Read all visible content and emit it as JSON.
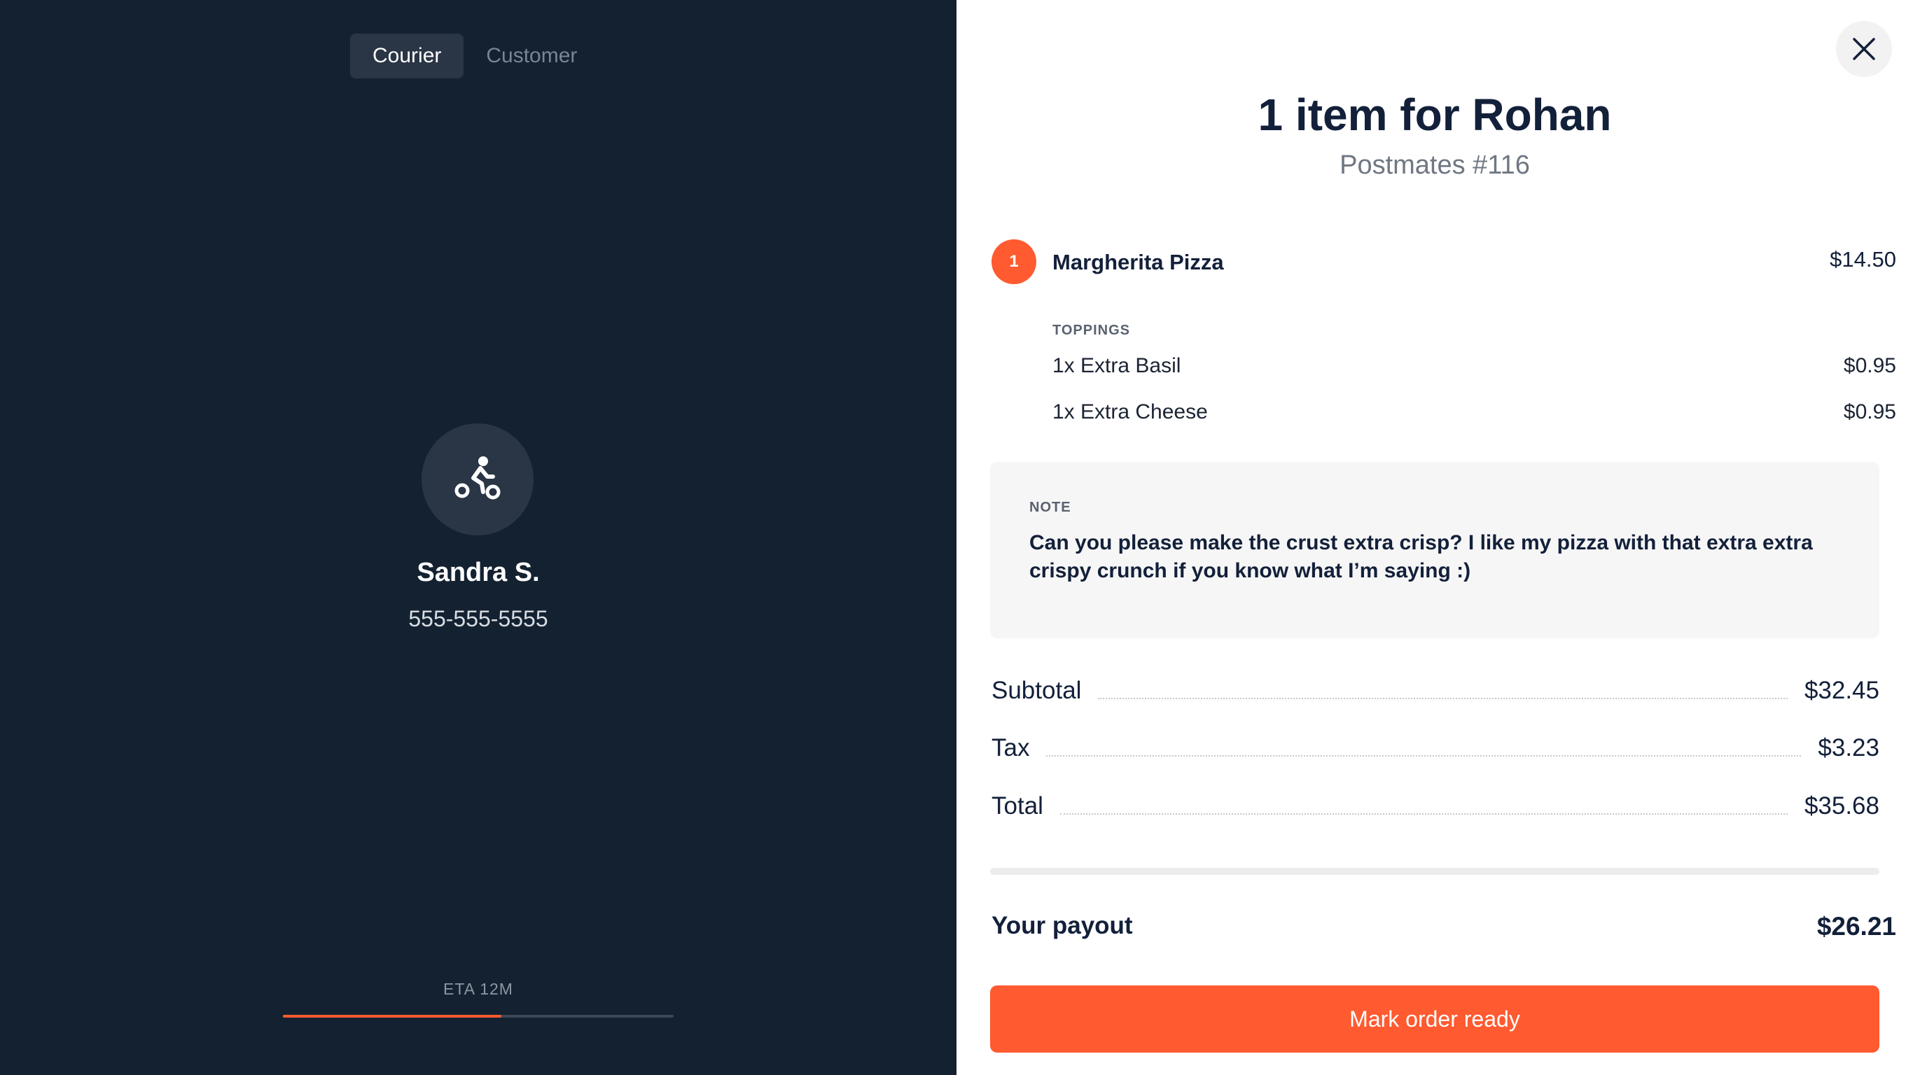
{
  "tabs": [
    {
      "label": "Courier",
      "active": true
    },
    {
      "label": "Customer",
      "active": false
    }
  ],
  "courier": {
    "icon": "cyclist-icon",
    "name": "Sandra S.",
    "phone": "555-555-5555"
  },
  "eta": {
    "label": "ETA 12M",
    "progress": 0.56
  },
  "order": {
    "title": "1 item for Rohan",
    "subtitle": "Postmates #116",
    "items": [
      {
        "quantity": "1",
        "name": "Margherita Pizza",
        "price": "$14.50",
        "modifier_group": "TOPPINGS",
        "modifiers": [
          {
            "label": "1x Extra Basil",
            "price": "$0.95"
          },
          {
            "label": "1x Extra Cheese",
            "price": "$0.95"
          }
        ]
      }
    ],
    "note": {
      "label": "NOTE",
      "text": "Can you please make the crust extra crisp? I like my pizza with that extra extra crispy crunch if you know what I’m saying :)"
    },
    "totals": [
      {
        "label": "Subtotal",
        "value": "$32.45"
      },
      {
        "label": "Tax",
        "value": "$3.23"
      },
      {
        "label": "Total",
        "value": "$35.68"
      }
    ],
    "payout": {
      "label": "Your payout",
      "value": "$26.21"
    },
    "action_label": "Mark order ready"
  },
  "colors": {
    "accent": "#ff5a30",
    "dark_panel": "#132131",
    "text_dark": "#13203a"
  }
}
